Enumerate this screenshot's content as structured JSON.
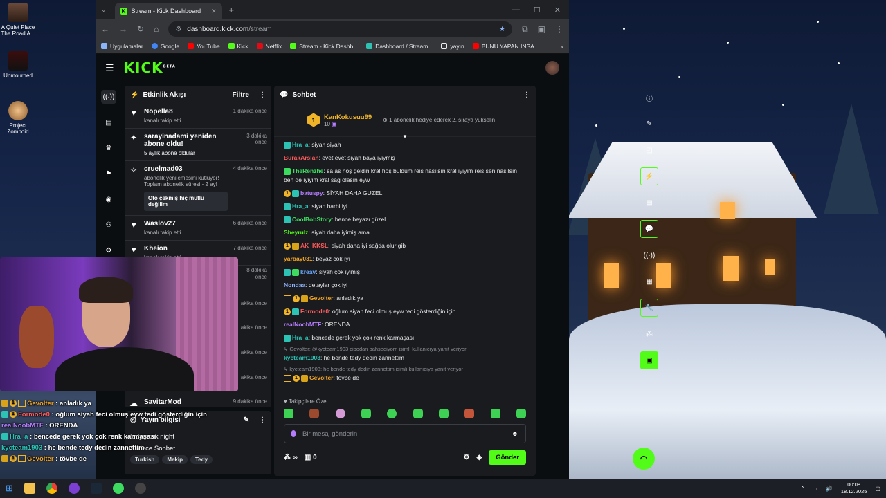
{
  "desktop": {
    "icons": [
      {
        "label": "A Quiet Place The Road A..."
      },
      {
        "label": "Unmourned"
      },
      {
        "label": "Project Zomboid"
      }
    ]
  },
  "browser": {
    "tab_title": "Stream - Kick Dashboard",
    "url_domain": "dashboard.kick.com",
    "url_path": "/stream",
    "bookmarks": [
      "Uygulamalar",
      "Google",
      "YouTube",
      "Kick",
      "Netflix",
      "Stream - Kick Dashb...",
      "Dashboard / Stream...",
      "yayın",
      "BUNU YAPAN İNSA..."
    ]
  },
  "kick": {
    "logo": "KICK",
    "logo_sup": "BETA",
    "activity": {
      "title": "Etkinlik Akışı",
      "filter": "Filtre",
      "items": [
        {
          "name": "Nopella8",
          "sub": "kanalı takip etti",
          "time": "1 dakika önce"
        },
        {
          "name": "sarayinadami yeniden abone oldu!",
          "sub": "5 aylık abone oldular",
          "time": "3 dakika önce"
        },
        {
          "name": "cruelmad03",
          "sub": "abonelik yenilemesini kutluyor! Toplam abonelik süresi - 2 ay!",
          "msg": "Oto çekmiş hiç mutlu değilim",
          "time": "4 dakika önce"
        },
        {
          "name": "Waslov27",
          "sub": "kanalı takip etti",
          "time": "6 dakika önce"
        },
        {
          "name": "Kheion",
          "sub": "kanalı takip etti",
          "time": "7 dakika önce"
        },
        {
          "name": "SavitarMod",
          "sub": "",
          "time": "9 dakika önce"
        }
      ],
      "hidden_times": [
        "8 dakika önce",
        "akika önce",
        "akika önce",
        "akika önce",
        "akika önce"
      ]
    },
    "stream_info": {
      "title": "Yayın bilgisi",
      "stream_name": "tedymcek night",
      "mode": "Sadece Sohbet",
      "tags": [
        "Turkish",
        "Mekip",
        "Tedy"
      ]
    },
    "chat": {
      "title": "Sohbet",
      "top_gifter": {
        "name": "KanKokusuu99",
        "count": "10",
        "hint": "1 abonelik hediye ederek 2. sıraya yükselin"
      },
      "messages": [
        {
          "user": "Hra_a",
          "color": "#2cc3b5",
          "text": "siyah siyah"
        },
        {
          "user": "BurakArslan",
          "color": "#ff5c5c",
          "text": "evet evet siyah baya iyiymiş"
        },
        {
          "user": "TheRenzhe",
          "color": "#3ddc61",
          "text": "sa as hoş geldin kral hoş buldum reis nasılsın kral iyiyim reis sen nasılsın ben de iyiyim kral sağ olasın eyw"
        },
        {
          "user": "batuspy",
          "color": "#b67cff",
          "text": "SİYAH DAHA GUZEL"
        },
        {
          "user": "Hra_a",
          "color": "#2cc3b5",
          "text": "siyah harbi iyi"
        },
        {
          "user": "CoolBobStory",
          "color": "#3ddc61",
          "text": "bence beyazı güzel"
        },
        {
          "user": "Sheyrulz",
          "color": "#53fc18",
          "text": "siyah daha iyimiş ama"
        },
        {
          "user": "AK_KKSL",
          "color": "#ff5c5c",
          "text": "siyah daha iyi sağda olur gib"
        },
        {
          "user": "yarbay031",
          "color": "#f5a623",
          "text": "beyaz cok ıyı"
        },
        {
          "user": "kreav",
          "color": "#6aa8ff",
          "text": "siyah çok iyimiş"
        },
        {
          "user": "Nondaa",
          "color": "#8fb3ff",
          "text": "detaylar çok iyi"
        },
        {
          "user": "Gevolter",
          "color": "#f5a623",
          "text": "anladık ya"
        },
        {
          "user": "Formode0",
          "color": "#ff5c5c",
          "text": "oğlum siyah feci olmuş eyw tedi gösterdiğin için"
        },
        {
          "user": "realNoobMTF",
          "color": "#b67cff",
          "text": "ORENDA"
        },
        {
          "user": "Hra_a",
          "color": "#2cc3b5",
          "text": "bencede gerek yok çok renk karmaşası"
        },
        {
          "reply": "Gevolter: @kycteam1903 cibodan bahsediyorn isimli kullanıcıya yanıt veriyor",
          "user": "kycteam1903",
          "color": "#2cc3b5",
          "text": "he bende tedy dedin zannettim"
        },
        {
          "reply": "kycteam1903: he bende tedy dedin zannettim isimli kullanıcıya yanıt veriyor",
          "user": "Gevolter",
          "color": "#f5a623",
          "text": "tövbe de"
        }
      ],
      "followers_only": "Takipçilere Özel",
      "input_placeholder": "Bir mesaj gönderin",
      "points": "∞",
      "gift_count": "0",
      "send_label": "Gönder"
    }
  },
  "overlay_chat": [
    {
      "user": "Gevolter",
      "color": "#f5a623",
      "text": "anladık ya"
    },
    {
      "user": "Formode0",
      "color": "#ff5c5c",
      "text": "oğlum siyah feci olmuş eyw tedi gösterdiğin için"
    },
    {
      "user": "realNoobMTF",
      "color": "#b67cff",
      "text": "ORENDA"
    },
    {
      "user": "Hra_a",
      "color": "#2cc3b5",
      "text": "bencede gerek yok çok renk karmaşası"
    },
    {
      "user": "kycteam1903",
      "color": "#2cc3b5",
      "text": "he bende tedy dedin zannettim"
    },
    {
      "user": "Gevolter",
      "color": "#f5a623",
      "text": "tövbe de"
    }
  ],
  "taskbar": {
    "time": "00:08",
    "date": "18.12.2025"
  },
  "colors": {
    "accent": "#53fc18",
    "panel": "#191b1f",
    "bg": "#0b0e11"
  }
}
